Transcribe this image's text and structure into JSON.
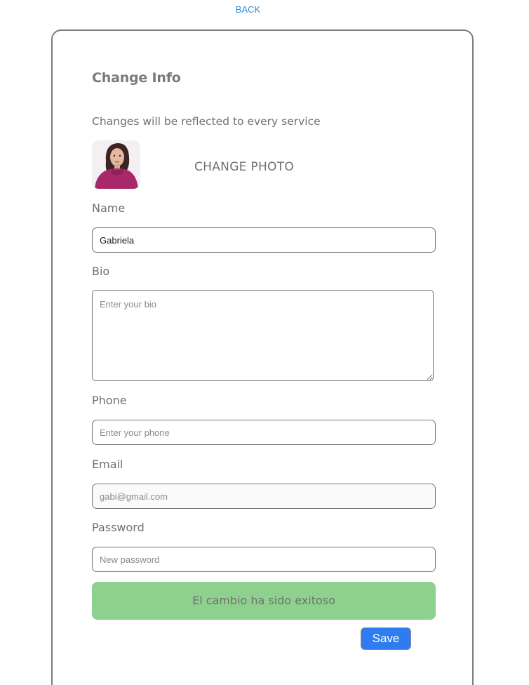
{
  "header": {
    "back_label": "BACK"
  },
  "card": {
    "title": "Change Info",
    "subtitle": "Changes will be reflected to every service",
    "change_photo_label": "CHANGE PHOTO",
    "avatar_icon": "profile-photo"
  },
  "form": {
    "name": {
      "label": "Name",
      "value": "Gabriela",
      "placeholder": ""
    },
    "bio": {
      "label": "Bio",
      "value": "",
      "placeholder": "Enter your bio"
    },
    "phone": {
      "label": "Phone",
      "value": "",
      "placeholder": "Enter your phone"
    },
    "email": {
      "label": "Email",
      "value": "",
      "placeholder": "gabi@gmail.com"
    },
    "password": {
      "label": "Password",
      "value": "",
      "placeholder": "New password"
    }
  },
  "status": {
    "message": "El cambio ha sido exitoso",
    "color": "#8ed18e"
  },
  "actions": {
    "save_label": "Save",
    "save_color": "#2e7cf0"
  }
}
